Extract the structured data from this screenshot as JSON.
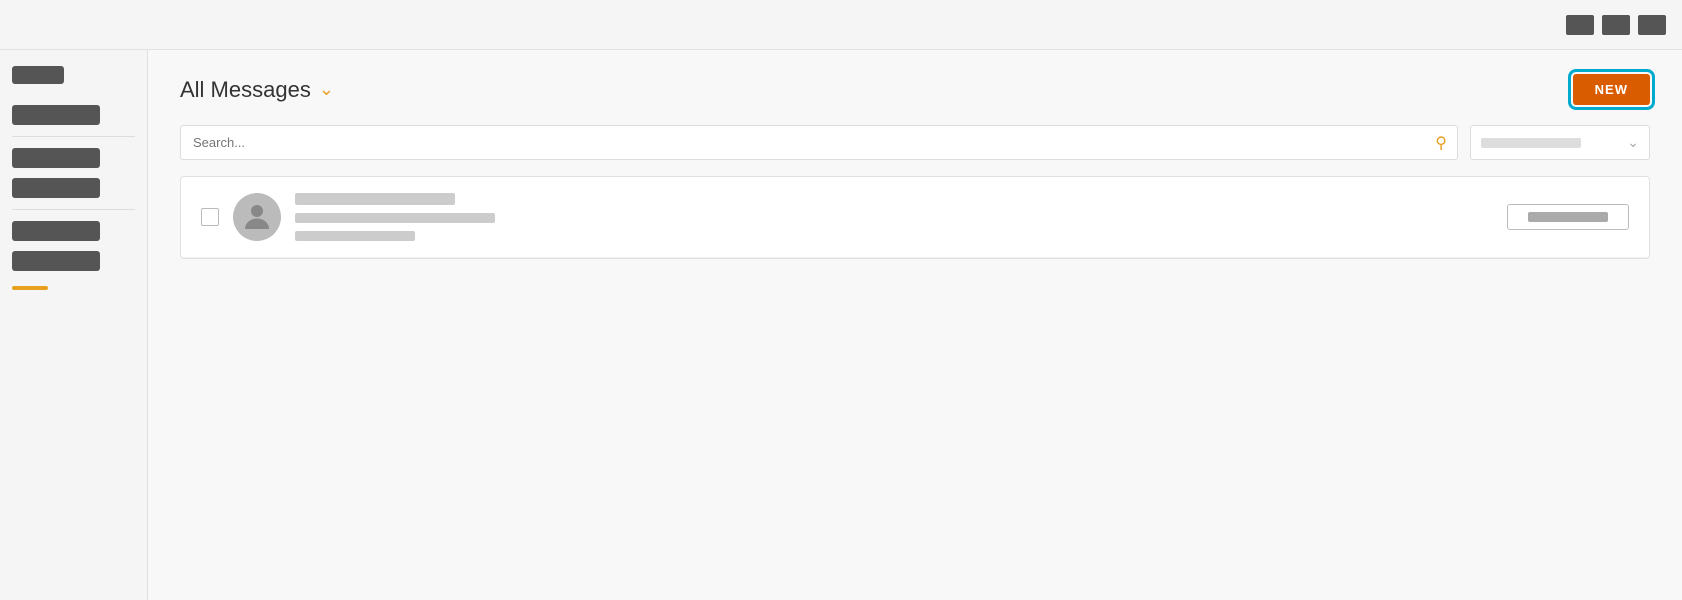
{
  "topbar": {
    "icons": [
      "grid-icon",
      "list-icon",
      "menu-icon"
    ]
  },
  "sidebar": {
    "top_item_label": "",
    "items": [
      "",
      "",
      "",
      "",
      ""
    ],
    "accent": true
  },
  "header": {
    "page_title": "All Messages",
    "new_button_label": "NEW"
  },
  "search": {
    "placeholder": "Search...",
    "filter_placeholder": ""
  },
  "messages": [
    {
      "line1": "",
      "line2": "",
      "line3": "",
      "action_label": ""
    }
  ],
  "colors": {
    "accent_orange": "#e8a020",
    "button_orange": "#d95c00",
    "highlight_blue": "#00aacc",
    "sidebar_bg": "#f5f5f5",
    "content_bg": "#f8f8f8"
  }
}
